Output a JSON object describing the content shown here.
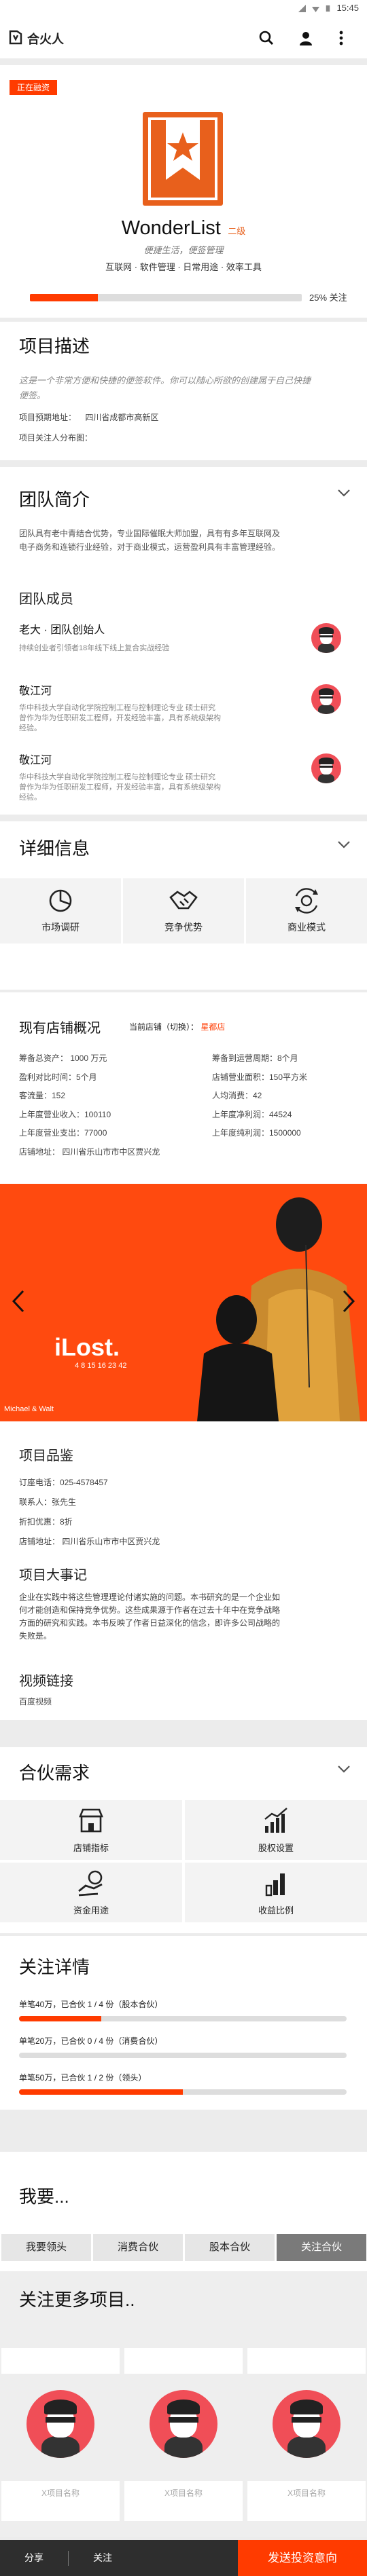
{
  "status_bar": {
    "time": "15:45"
  },
  "header": {
    "brand": "合火人"
  },
  "project": {
    "badge": "正在融资",
    "name": "WonderList",
    "level": "二级",
    "slogan": "便捷生活，便签管理",
    "tags": "互联网 · 软件管理 · 日常用途 · 效率工具",
    "follow_percent": 25,
    "follow_label": "25% 关注"
  },
  "description": {
    "title": "项目描述",
    "text_line1": "这是一个非常方便和快捷的便签软件。你可以随心所欲的创建属于自己快捷",
    "text_line2": "便签。",
    "address_label": "项目预期地址：",
    "address": "四川省成都市高新区",
    "audience_label": "项目关注人分布图："
  },
  "team": {
    "title": "团队简介",
    "intro_line1": "团队具有老中青结合优势，专业国际催眠大师加盟，具有有多年互联网及",
    "intro_line2": "电子商务和连锁行业经验，对于商业模式，运营盈利具有丰富管理经验。",
    "members_title": "团队成员",
    "members": [
      {
        "name": "老大 · 团队创始人",
        "line1": "持续创业者引领者18年线下线上复合实战经验",
        "line2": ""
      },
      {
        "name": "敬江河",
        "line1": "华中科技大学自动化学院控制工程与控制理论专业 硕士研究",
        "line2": "曾作为华为任职研发工程师，开发经验丰富，具有系统级架构",
        "line3": "经验。"
      },
      {
        "name": "敬江河",
        "line1": "华中科技大学自动化学院控制工程与控制理论专业 硕士研究",
        "line2": "曾作为华为任职研发工程师，开发经验丰富，具有系统级架构",
        "line3": "经验。"
      }
    ]
  },
  "details": {
    "title": "详细信息",
    "items": [
      {
        "label": "市场调研",
        "icon": "pie-chart-icon"
      },
      {
        "label": "竞争优势",
        "icon": "handshake-icon"
      },
      {
        "label": "商业模式",
        "icon": "money-cycle-icon"
      }
    ]
  },
  "store": {
    "title": "现有店铺概况",
    "current_label": "当前店铺（切换）：",
    "current_value": "星都店",
    "left": [
      "筹备总资产：  1000 万元",
      "盈利对比时间：5个月",
      "客流量：152",
      "上年度营业收入：100110",
      "上年度营业支出：77000",
      "店铺地址：  四川省乐山市市中区贾兴龙"
    ],
    "right": [
      "筹备到运营周期：8个月",
      "店铺营业面积：150平方米",
      "人均消费：42",
      "上年度净利润：44524",
      "上年度纯利润：1500000"
    ]
  },
  "banner": {
    "title": "iLost.",
    "subtitle": "4 8 15 16 23 42",
    "credit": "Michael & Walt"
  },
  "product": {
    "title": "项目品鉴",
    "lines": [
      "订座电话：025-4578457",
      "联系人：张先生",
      "折扣优惠：8折",
      "店铺地址：  四川省乐山市市中区贾兴龙"
    ]
  },
  "events": {
    "title": "项目大事记",
    "line1": "企业在实践中将这些管理理论付诸实施的问题。本书研究的是一个企业如",
    "line2": "何才能创造和保持竞争优势。这些成果源于作者在过去十年中在竞争战略",
    "line3": "方面的研究和实践。本书反映了作者日益深化的信念，即许多公司战略的",
    "line4": "失败是。"
  },
  "video": {
    "title": "视频链接",
    "link": "百度视频"
  },
  "partner": {
    "title": "合伙需求",
    "items": [
      {
        "label": "店铺指标",
        "icon": "store-icon"
      },
      {
        "label": "股权设置",
        "icon": "growth-chart-icon"
      },
      {
        "label": "资金用途",
        "icon": "coin-hand-icon"
      },
      {
        "label": "收益比例",
        "icon": "bar-chart-icon"
      }
    ]
  },
  "follow": {
    "title": "关注详情",
    "rows": [
      {
        "label": "单笔40万，已合伙 1 / 4 份（股本合伙）",
        "ratio": 0.25
      },
      {
        "label": "单笔20万，已合伙 0 / 4 份（消费合伙）",
        "ratio": 0.0
      },
      {
        "label": "单笔50万，已合伙 1 / 2 份（领头）",
        "ratio": 0.5
      }
    ]
  },
  "iwant": {
    "title": "我要...",
    "tabs": [
      "我要领头",
      "消费合伙",
      "股本合伙",
      "关注合伙"
    ],
    "active": 3
  },
  "more": {
    "title": "关注更多项目..",
    "cards": [
      {
        "caption": "X项目名称"
      },
      {
        "caption": "X项目名称"
      },
      {
        "caption": "X项目名称"
      }
    ]
  },
  "bottom_bar": {
    "share": "分享",
    "follow": "关注",
    "invest": "发送投资意向"
  },
  "colors": {
    "accent": "#ff3b00",
    "logo": "#e8601c",
    "banner": "#ff4a0f"
  }
}
